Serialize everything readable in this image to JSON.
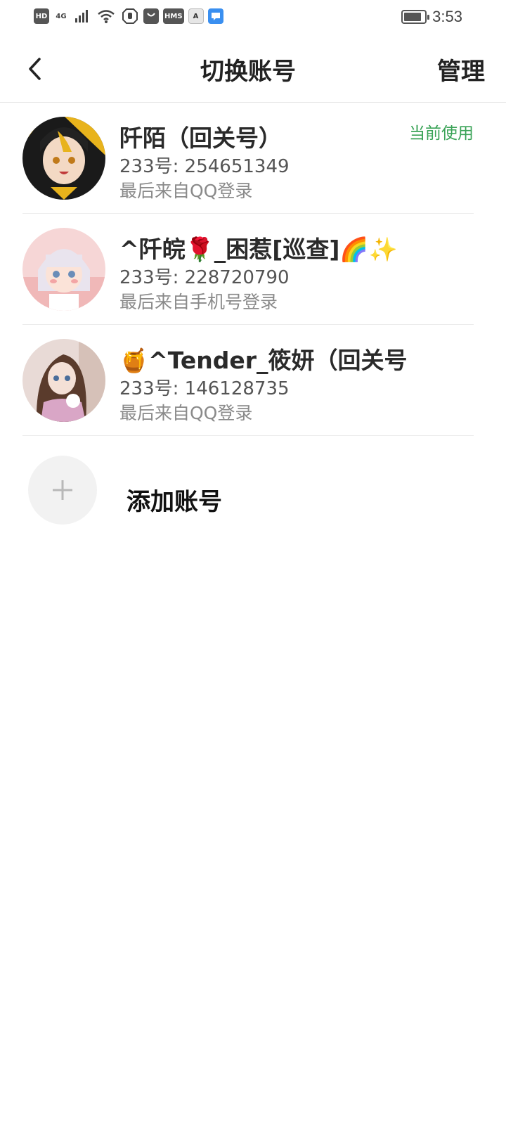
{
  "status_bar": {
    "icons": [
      "HD",
      "4G",
      "signal-icon",
      "wifi-icon",
      "hand-icon",
      "bag-icon",
      "HMS",
      "A",
      "chat-icon"
    ],
    "hd_label": "HD",
    "network_label": "4G",
    "hms_label": "HMS",
    "a_label": "A",
    "time": "3:53"
  },
  "header": {
    "title": "切换账号",
    "manage_label": "管理",
    "back_icon": "chevron-left-icon"
  },
  "accounts": [
    {
      "name": "阡陌（回关号）",
      "id_line": "233号: 254651349",
      "login_line": "最后来自QQ登录",
      "badge": "当前使用",
      "avatar_color": "#e8b31c"
    },
    {
      "name": "^阡皖🌹_困惹[巡查]🌈✨",
      "id_line": "233号: 228720790",
      "login_line": "最后来自手机号登录",
      "badge": "",
      "avatar_color": "#f5c9c9"
    },
    {
      "name": "🍯^Tender_筱妍（回关号",
      "id_line": "233号: 146128735",
      "login_line": "最后来自QQ登录",
      "badge": "",
      "avatar_color": "#c9a9c6"
    }
  ],
  "add_account": {
    "label": "添加账号",
    "icon": "plus-icon"
  },
  "colors": {
    "accent_green": "#3aa357",
    "text_primary": "#222222",
    "text_secondary": "#8a8a8a"
  }
}
